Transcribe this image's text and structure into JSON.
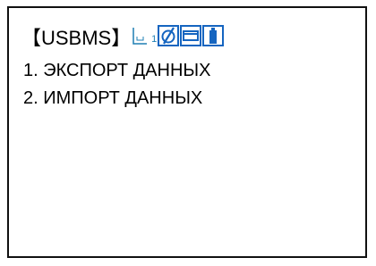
{
  "screen": {
    "title": "【USBMS】",
    "status_bar": {
      "number": "1",
      "icons": [
        "angle-tilt-icon",
        "message-icon",
        "battery-icon"
      ],
      "icon_color": "#1565c0"
    }
  },
  "menu": {
    "items": [
      {
        "label": "1. ЭКСПОРТ ДАННЫХ"
      },
      {
        "label": "2. ИМПОРТ ДАННЫХ"
      }
    ]
  }
}
